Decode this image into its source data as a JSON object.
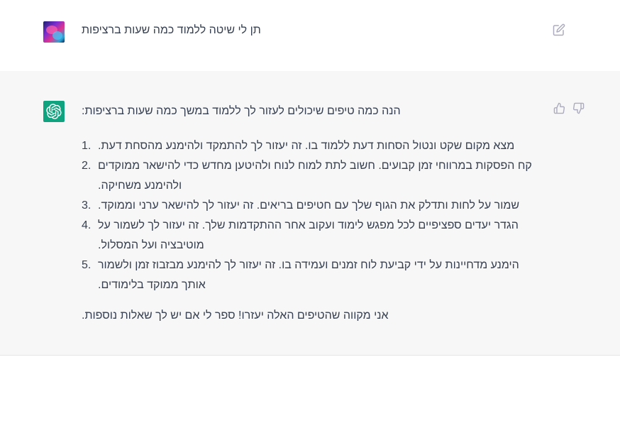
{
  "conversation": {
    "user_message": {
      "avatar": "user-avatar",
      "text": "תן לי שיטה ללמוד כמה שעות ברציפות"
    },
    "assistant_message": {
      "avatar": "openai-logo",
      "intro": "הנה כמה טיפים שיכולים לעזור לך ללמוד במשך כמה שעות ברציפות:",
      "tips": [
        {
          "num": "1.",
          "text": "מצא מקום שקט ונטול הסחות דעת ללמוד בו. זה יעזור לך להתמקד ולהימנע מהסחת דעת."
        },
        {
          "num": "2.",
          "text": "קח הפסקות במרווחי זמן קבועים. חשוב לתת למוח לנוח ולהיטען מחדש כדי להישאר ממוקדים ולהימנע משחיקה."
        },
        {
          "num": "3.",
          "text": "שמור על לחות ותדלק את הגוף שלך עם חטיפים בריאים. זה יעזור לך להישאר ערני וממוקד."
        },
        {
          "num": "4.",
          "text": "הגדר יעדים ספציפיים לכל מפגש לימוד ועקוב אחר ההתקדמות שלך. זה יעזור לך לשמור על מוטיבציה ועל המסלול."
        },
        {
          "num": "5.",
          "text": "הימנע מדחיינות על ידי קביעת לוח זמנים ועמידה בו. זה יעזור לך להימנע מבזבוז זמן ולשמור אותך ממוקד בלימודים."
        }
      ],
      "outro": "אני מקווה שהטיפים האלה יעזרו! ספר לי אם יש לך שאלות נוספות."
    },
    "icons": {
      "edit": "edit-icon",
      "like": "thumbs-up-icon",
      "dislike": "thumbs-down-icon"
    },
    "colors": {
      "assistant_bg": "#f7f7f8",
      "openai_green": "#10a37f",
      "text": "#374151",
      "icon_gray": "#acacbe"
    }
  }
}
